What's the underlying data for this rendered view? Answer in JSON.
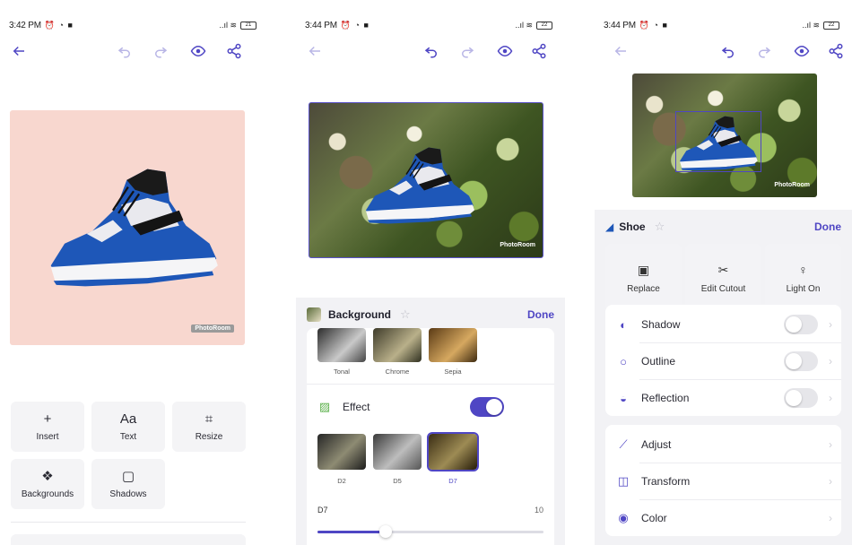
{
  "screens": [
    {
      "status": {
        "time": "3:42 PM",
        "glyphs": "⏰ ◔ ■",
        "signal": "..ıl ≋",
        "battery": "21"
      },
      "photo_watermark": "PhotoRoom",
      "tools": [
        {
          "icon": "+",
          "label": "Insert"
        },
        {
          "icon": "Aa",
          "label": "Text"
        },
        {
          "icon": "⌗",
          "label": "Resize"
        },
        {
          "icon": "❖",
          "label": "Backgrounds"
        },
        {
          "icon": "▢",
          "label": "Shadows"
        }
      ]
    },
    {
      "status": {
        "time": "3:44 PM",
        "glyphs": "⏰ ◔ ■",
        "signal": "..ıl ≋",
        "battery": "22"
      },
      "photo_watermark": "PhotoRoom",
      "sheet": {
        "title": "Background",
        "done": "Done",
        "filters": [
          "Tonal",
          "Chrome",
          "Sepia"
        ],
        "effect_label": "Effect",
        "effect_on": true,
        "effects": [
          "D2",
          "D5",
          "D7"
        ],
        "selected_effect": "D7",
        "slider_label": "D7",
        "slider_max": "10",
        "slider_value": 3
      }
    },
    {
      "status": {
        "time": "3:44 PM",
        "glyphs": "⏰ ◔ ■",
        "signal": "..ıl ≋",
        "battery": "22"
      },
      "photo_watermark": "PhotoRoom",
      "sheet": {
        "title": "Shoe",
        "done": "Done",
        "actions": [
          {
            "icon": "▣",
            "label": "Replace"
          },
          {
            "icon": "✂",
            "label": "Edit Cutout"
          },
          {
            "icon": "♀",
            "label": "Light On"
          }
        ],
        "toggles": [
          {
            "icon": "◐",
            "label": "Shadow",
            "on": false
          },
          {
            "icon": "○",
            "label": "Outline",
            "on": false
          },
          {
            "icon": "◒",
            "label": "Reflection",
            "on": false
          }
        ],
        "menu": [
          {
            "icon": "⟋",
            "label": "Adjust"
          },
          {
            "icon": "◫",
            "label": "Transform"
          },
          {
            "icon": "◉",
            "label": "Color"
          }
        ]
      }
    }
  ],
  "colors": {
    "accent": "#4f46c4",
    "pink_bg": "#f8d7cf",
    "sheet_bg": "#f2f2f5",
    "shoe_blue": "#1e57b8"
  }
}
